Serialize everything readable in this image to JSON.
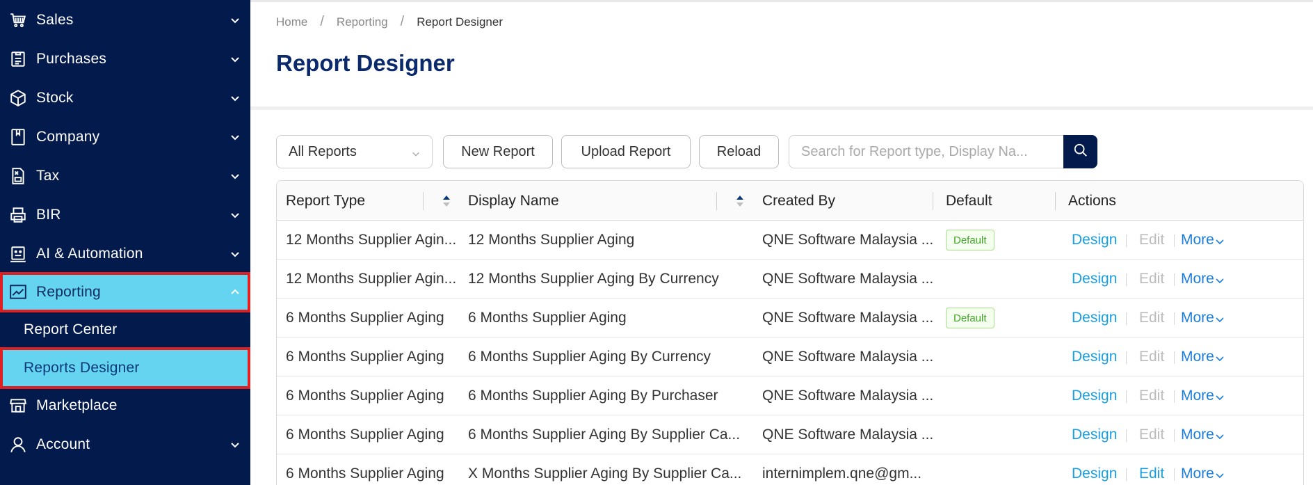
{
  "sidebar": {
    "items": [
      {
        "label": "Sales",
        "icon": "cart-icon"
      },
      {
        "label": "Purchases",
        "icon": "clipboard-icon"
      },
      {
        "label": "Stock",
        "icon": "box-icon"
      },
      {
        "label": "Company",
        "icon": "bookmark-icon"
      },
      {
        "label": "Tax",
        "icon": "tax-doc-icon"
      },
      {
        "label": "BIR",
        "icon": "printer-icon"
      },
      {
        "label": "AI & Automation",
        "icon": "robot-icon"
      },
      {
        "label": "Reporting",
        "icon": "chart-line-icon"
      }
    ],
    "subitems": [
      {
        "label": "Report Center"
      },
      {
        "label": "Reports Designer"
      }
    ],
    "bottom": [
      {
        "label": "Marketplace",
        "icon": "store-icon"
      },
      {
        "label": "Account",
        "icon": "user-icon"
      }
    ]
  },
  "breadcrumb": {
    "home": "Home",
    "section": "Reporting",
    "current": "Report Designer",
    "separator": "/"
  },
  "page": {
    "title": "Report Designer"
  },
  "toolbar": {
    "filter_value": "All Reports",
    "new_report": "New Report",
    "upload_report": "Upload Report",
    "reload": "Reload",
    "search_placeholder": "Search for Report type, Display Na..."
  },
  "table": {
    "headers": {
      "report_type": "Report Type",
      "display_name": "Display Name",
      "created_by": "Created By",
      "default": "Default",
      "actions": "Actions"
    },
    "action_labels": {
      "design": "Design",
      "edit": "Edit",
      "more": "More"
    },
    "badge_label": "Default",
    "rows": [
      {
        "report_type": "12 Months Supplier Agin...",
        "display_name": "12 Months Supplier Aging",
        "created_by": "QNE Software Malaysia ...",
        "is_default": true,
        "edit_enabled": false
      },
      {
        "report_type": "12 Months Supplier Agin...",
        "display_name": "12 Months Supplier Aging By Currency",
        "created_by": "QNE Software Malaysia ...",
        "is_default": false,
        "edit_enabled": false
      },
      {
        "report_type": "6 Months Supplier Aging",
        "display_name": "6 Months Supplier Aging",
        "created_by": "QNE Software Malaysia ...",
        "is_default": true,
        "edit_enabled": false
      },
      {
        "report_type": "6 Months Supplier Aging",
        "display_name": "6 Months Supplier Aging By Currency",
        "created_by": "QNE Software Malaysia ...",
        "is_default": false,
        "edit_enabled": false
      },
      {
        "report_type": "6 Months Supplier Aging",
        "display_name": "6 Months Supplier Aging By Purchaser",
        "created_by": "QNE Software Malaysia ...",
        "is_default": false,
        "edit_enabled": false
      },
      {
        "report_type": "6 Months Supplier Aging",
        "display_name": "6 Months Supplier Aging By Supplier Ca...",
        "created_by": "QNE Software Malaysia ...",
        "is_default": false,
        "edit_enabled": false
      },
      {
        "report_type": "6 Months Supplier Aging",
        "display_name": "X Months Supplier Aging By Supplier Ca...",
        "created_by": "internimplem.qne@gm...",
        "is_default": false,
        "edit_enabled": true
      }
    ]
  },
  "colors": {
    "sidebar_bg": "#031a4d",
    "active_bg": "#64d4f0",
    "highlight_border": "#e02020",
    "title": "#0b2a6b",
    "link": "#1aa0e0"
  }
}
